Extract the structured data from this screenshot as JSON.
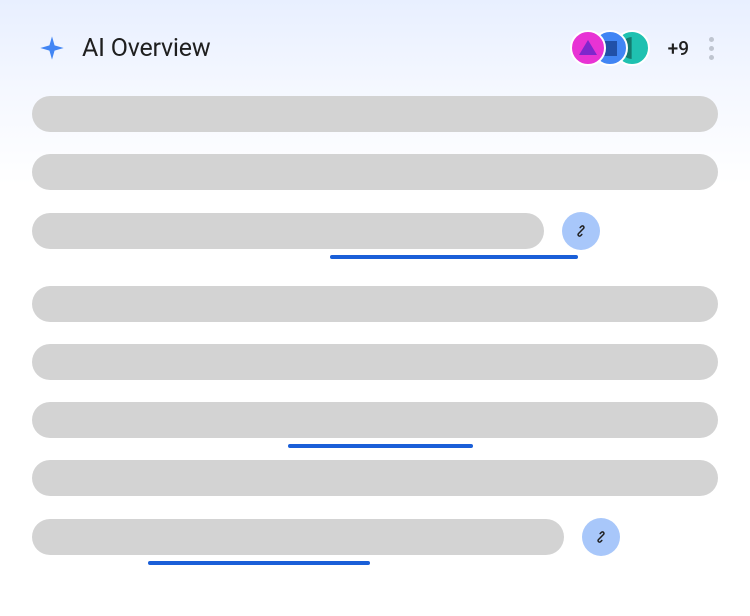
{
  "header": {
    "title": "AI Overview",
    "sources": {
      "avatars": [
        {
          "shape": "triangle",
          "bg": "#e833d4"
        },
        {
          "shape": "square",
          "bg": "#4185f4"
        },
        {
          "shape": "semicircle",
          "bg": "#1fc1b0"
        }
      ],
      "overflow_count": "+9"
    }
  },
  "content": {
    "blocks": [
      {
        "lines": [
          {
            "width": "full"
          },
          {
            "width": "full"
          },
          {
            "width": "partial-512",
            "underlined": true,
            "link_button": true
          }
        ]
      },
      {
        "lines": [
          {
            "width": "full"
          },
          {
            "width": "full"
          },
          {
            "width": "full",
            "underlined": true
          },
          {
            "width": "full"
          },
          {
            "width": "partial-532",
            "underlined": true,
            "link_button": true
          }
        ]
      }
    ]
  },
  "colors": {
    "placeholder": "#d3d3d3",
    "link_underline": "#1a5fd8",
    "link_button_bg": "#a8c7fa",
    "sparkle": "#4185f4"
  }
}
